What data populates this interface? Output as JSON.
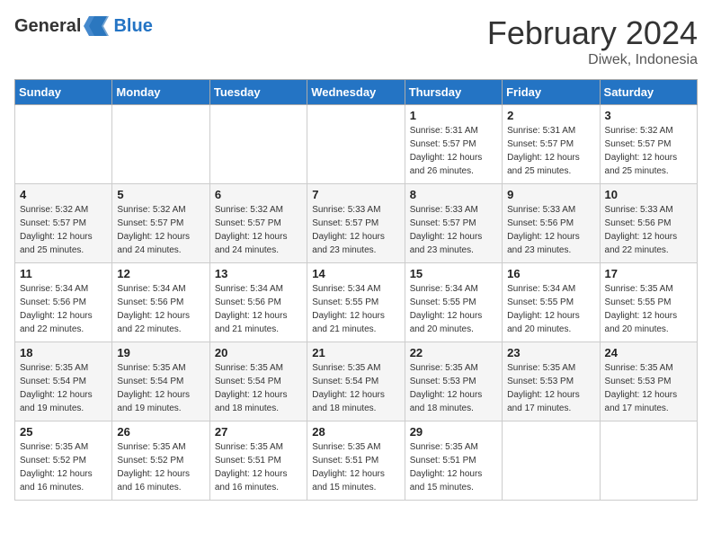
{
  "header": {
    "logo_general": "General",
    "logo_blue": "Blue",
    "title": "February 2024",
    "location": "Diwek, Indonesia"
  },
  "weekdays": [
    "Sunday",
    "Monday",
    "Tuesday",
    "Wednesday",
    "Thursday",
    "Friday",
    "Saturday"
  ],
  "weeks": [
    [
      {
        "day": "",
        "info": ""
      },
      {
        "day": "",
        "info": ""
      },
      {
        "day": "",
        "info": ""
      },
      {
        "day": "",
        "info": ""
      },
      {
        "day": "1",
        "info": "Sunrise: 5:31 AM\nSunset: 5:57 PM\nDaylight: 12 hours\nand 26 minutes."
      },
      {
        "day": "2",
        "info": "Sunrise: 5:31 AM\nSunset: 5:57 PM\nDaylight: 12 hours\nand 25 minutes."
      },
      {
        "day": "3",
        "info": "Sunrise: 5:32 AM\nSunset: 5:57 PM\nDaylight: 12 hours\nand 25 minutes."
      }
    ],
    [
      {
        "day": "4",
        "info": "Sunrise: 5:32 AM\nSunset: 5:57 PM\nDaylight: 12 hours\nand 25 minutes."
      },
      {
        "day": "5",
        "info": "Sunrise: 5:32 AM\nSunset: 5:57 PM\nDaylight: 12 hours\nand 24 minutes."
      },
      {
        "day": "6",
        "info": "Sunrise: 5:32 AM\nSunset: 5:57 PM\nDaylight: 12 hours\nand 24 minutes."
      },
      {
        "day": "7",
        "info": "Sunrise: 5:33 AM\nSunset: 5:57 PM\nDaylight: 12 hours\nand 23 minutes."
      },
      {
        "day": "8",
        "info": "Sunrise: 5:33 AM\nSunset: 5:57 PM\nDaylight: 12 hours\nand 23 minutes."
      },
      {
        "day": "9",
        "info": "Sunrise: 5:33 AM\nSunset: 5:56 PM\nDaylight: 12 hours\nand 23 minutes."
      },
      {
        "day": "10",
        "info": "Sunrise: 5:33 AM\nSunset: 5:56 PM\nDaylight: 12 hours\nand 22 minutes."
      }
    ],
    [
      {
        "day": "11",
        "info": "Sunrise: 5:34 AM\nSunset: 5:56 PM\nDaylight: 12 hours\nand 22 minutes."
      },
      {
        "day": "12",
        "info": "Sunrise: 5:34 AM\nSunset: 5:56 PM\nDaylight: 12 hours\nand 22 minutes."
      },
      {
        "day": "13",
        "info": "Sunrise: 5:34 AM\nSunset: 5:56 PM\nDaylight: 12 hours\nand 21 minutes."
      },
      {
        "day": "14",
        "info": "Sunrise: 5:34 AM\nSunset: 5:55 PM\nDaylight: 12 hours\nand 21 minutes."
      },
      {
        "day": "15",
        "info": "Sunrise: 5:34 AM\nSunset: 5:55 PM\nDaylight: 12 hours\nand 20 minutes."
      },
      {
        "day": "16",
        "info": "Sunrise: 5:34 AM\nSunset: 5:55 PM\nDaylight: 12 hours\nand 20 minutes."
      },
      {
        "day": "17",
        "info": "Sunrise: 5:35 AM\nSunset: 5:55 PM\nDaylight: 12 hours\nand 20 minutes."
      }
    ],
    [
      {
        "day": "18",
        "info": "Sunrise: 5:35 AM\nSunset: 5:54 PM\nDaylight: 12 hours\nand 19 minutes."
      },
      {
        "day": "19",
        "info": "Sunrise: 5:35 AM\nSunset: 5:54 PM\nDaylight: 12 hours\nand 19 minutes."
      },
      {
        "day": "20",
        "info": "Sunrise: 5:35 AM\nSunset: 5:54 PM\nDaylight: 12 hours\nand 18 minutes."
      },
      {
        "day": "21",
        "info": "Sunrise: 5:35 AM\nSunset: 5:54 PM\nDaylight: 12 hours\nand 18 minutes."
      },
      {
        "day": "22",
        "info": "Sunrise: 5:35 AM\nSunset: 5:53 PM\nDaylight: 12 hours\nand 18 minutes."
      },
      {
        "day": "23",
        "info": "Sunrise: 5:35 AM\nSunset: 5:53 PM\nDaylight: 12 hours\nand 17 minutes."
      },
      {
        "day": "24",
        "info": "Sunrise: 5:35 AM\nSunset: 5:53 PM\nDaylight: 12 hours\nand 17 minutes."
      }
    ],
    [
      {
        "day": "25",
        "info": "Sunrise: 5:35 AM\nSunset: 5:52 PM\nDaylight: 12 hours\nand 16 minutes."
      },
      {
        "day": "26",
        "info": "Sunrise: 5:35 AM\nSunset: 5:52 PM\nDaylight: 12 hours\nand 16 minutes."
      },
      {
        "day": "27",
        "info": "Sunrise: 5:35 AM\nSunset: 5:51 PM\nDaylight: 12 hours\nand 16 minutes."
      },
      {
        "day": "28",
        "info": "Sunrise: 5:35 AM\nSunset: 5:51 PM\nDaylight: 12 hours\nand 15 minutes."
      },
      {
        "day": "29",
        "info": "Sunrise: 5:35 AM\nSunset: 5:51 PM\nDaylight: 12 hours\nand 15 minutes."
      },
      {
        "day": "",
        "info": ""
      },
      {
        "day": "",
        "info": ""
      }
    ]
  ]
}
